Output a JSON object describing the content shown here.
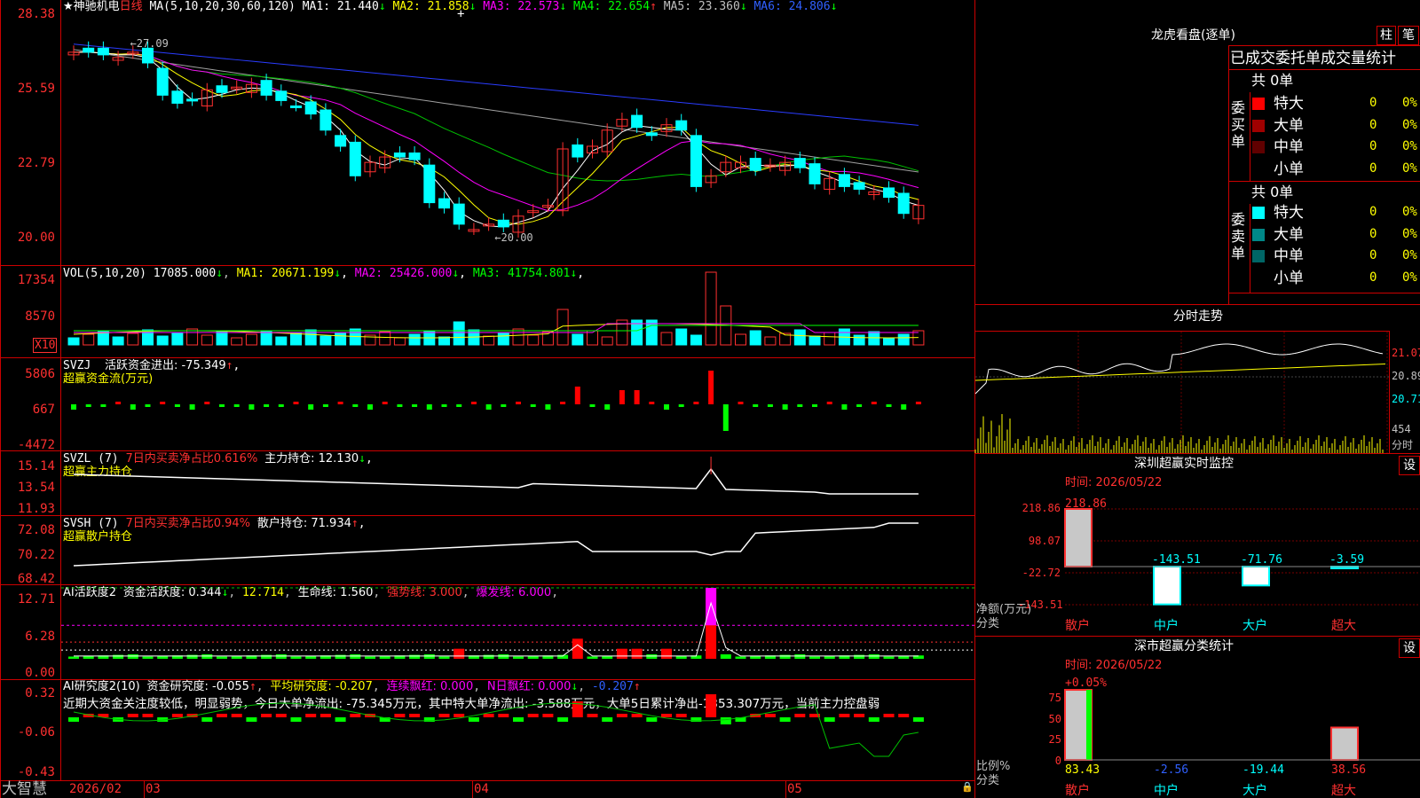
{
  "stock": {
    "name": "神驰机电",
    "period": "日线",
    "star": "★"
  },
  "kline": {
    "ma_prefix": "MA(5,10,20,30,60,120)",
    "ma": [
      {
        "label": "MA1: 21.440",
        "arrow": "↓",
        "color": "#ffffff"
      },
      {
        "label": "MA2: 21.858",
        "arrow": "↓",
        "color": "#ffff00"
      },
      {
        "label": "MA3: 22.573",
        "arrow": "↓",
        "color": "#ff00ff"
      },
      {
        "label": "MA4: 22.654",
        "arrow": "↑",
        "color": "#00ff00"
      },
      {
        "label": "MA5: 23.360",
        "arrow": "↓",
        "color": "#c0c0c0"
      },
      {
        "label": "MA6: 24.806",
        "arrow": "↓",
        "color": "#3060ff"
      }
    ],
    "yticks": [
      "28.38",
      "25.59",
      "22.79",
      "20.00"
    ],
    "high_mark": "27.09",
    "low_mark": "20.00",
    "closes": [
      26.9,
      26.9,
      26.8,
      26.7,
      26.9,
      26.5,
      25.3,
      25.0,
      25.1,
      25.5,
      25.4,
      25.6,
      25.7,
      25.3,
      25.1,
      24.9,
      24.6,
      24.0,
      23.4,
      22.3,
      22.8,
      23.0,
      23.0,
      22.9,
      21.3,
      21.1,
      20.5,
      20.3,
      20.5,
      20.4,
      20.8,
      21.0,
      21.2,
      23.3,
      23.0,
      23.4,
      24.0,
      24.4,
      24.1,
      23.8,
      24.2,
      24.0,
      21.9,
      22.3,
      22.8,
      22.8,
      22.5,
      22.7,
      22.8,
      22.6,
      22.0,
      22.2,
      21.9,
      21.8,
      21.7,
      21.5,
      20.9,
      21.2
    ]
  },
  "vol": {
    "prefix": "VOL(5,10,20)",
    "value": "17085.000",
    "arrow": "↓",
    "ma": [
      {
        "label": "MA1: 20671.199",
        "arrow": "↓",
        "color": "#ffff00"
      },
      {
        "label": "MA2: 25426.000",
        "arrow": "↓",
        "color": "#ff00ff"
      },
      {
        "label": "MA3: 41754.801",
        "arrow": "↓",
        "color": "#00ff00"
      }
    ],
    "yticks": [
      "17354",
      "8570",
      "X10"
    ]
  },
  "svzj": {
    "prefix": "SVZJ",
    "label": "活跃资金进出: -75.349",
    "arrow": "↑",
    "suffix": ",",
    "name": "超赢资金流(万元)",
    "yticks": [
      "5806",
      "667",
      "-4472"
    ]
  },
  "svzl": {
    "prefix": "SVZL (7)",
    "label1": "7日内买卖净占比0.616%",
    "label2": "主力持仓: 12.130",
    "arrow": "↓",
    "suffix": ",",
    "name": "超赢主力持仓",
    "yticks": [
      "15.14",
      "13.54",
      "11.93"
    ]
  },
  "svsh": {
    "prefix": "SVSH (7)",
    "label1": "7日内买卖净占比0.94%",
    "label2": "散户持仓: 71.934",
    "arrow": "↑",
    "suffix": ",",
    "name": "超赢散户持仓",
    "yticks": [
      "72.08",
      "70.22",
      "68.42"
    ]
  },
  "ai2": {
    "prefix": "AI活跃度2",
    "l1": "资金活跃度: 0.344",
    "a1": "↓",
    "l2": "12.714",
    "l3": "生命线: 1.560",
    "l4": "强势线: 3.000",
    "l5": "爆发线: 6.000",
    "yticks": [
      "12.71",
      "6.28",
      "0.00"
    ]
  },
  "ai_research": {
    "prefix": "AI研究度2(10)",
    "l1": "资金研究度: -0.055",
    "a1": "↑",
    "l2": "平均研究度: -0.207",
    "l3": "连续飘红: 0.000",
    "l4": "N日飘红: 0.000",
    "a4": "↓",
    "l5": "-0.207",
    "a5": "↑",
    "comment": "近期大资金关注度较低，明显弱势，今日大单净流出: -75.345万元，其中特大单净流出: -3.588万元，大单5日累计净出-1353.307万元，当前主力控盘弱",
    "yticks": [
      "0.32",
      "-0.06",
      "-0.43"
    ]
  },
  "footer": {
    "brand": "大智慧",
    "dates": [
      "2026/02",
      "03",
      "04",
      "05"
    ]
  },
  "longhu": {
    "title": "龙虎看盘(逐单)",
    "btn1": "柱",
    "btn2": "笔",
    "header": "已成交委托单成交量统计",
    "buy": {
      "side": "委买单",
      "total": "共 0单",
      "rows": [
        {
          "label": "特大",
          "v": "0",
          "p": "0%",
          "color": "#ff0000"
        },
        {
          "label": "大单",
          "v": "0",
          "p": "0%",
          "color": "#a00000"
        },
        {
          "label": "中单",
          "v": "0",
          "p": "0%",
          "color": "#600000"
        },
        {
          "label": "小单",
          "v": "0",
          "p": "0%",
          "color": ""
        }
      ]
    },
    "sell": {
      "side": "委卖单",
      "total": "共 0单",
      "rows": [
        {
          "label": "特大",
          "v": "0",
          "p": "0%",
          "color": "#00ffff"
        },
        {
          "label": "大单",
          "v": "0",
          "p": "0%",
          "color": "#008888"
        },
        {
          "label": "中单",
          "v": "0",
          "p": "0%",
          "color": "#006666"
        },
        {
          "label": "小单",
          "v": "0",
          "p": "0%",
          "color": ""
        }
      ]
    }
  },
  "fenshi": {
    "title": "分时走势",
    "yticks": [
      "21.07",
      "20.89",
      "20.71"
    ],
    "vol_label": "454",
    "vol_unit": "分时"
  },
  "monitor": {
    "title": "深圳超赢实时监控",
    "btn": "设",
    "time": "时间: 2026/05/22",
    "yticks": [
      "218.86",
      "98.07",
      "-22.72",
      "-143.51"
    ],
    "ylabel": "净额(万元)",
    "xlabel": "分类",
    "cats": [
      "散户",
      "中户",
      "大户",
      "超大"
    ],
    "values": [
      218.86,
      -143.51,
      -71.76,
      -3.59
    ],
    "value_labels": [
      "218.86",
      "-143.51",
      "-71.76",
      "-3.59"
    ]
  },
  "classify": {
    "title": "深市超赢分类统计",
    "btn": "设",
    "time": "时间: 2026/05/22",
    "top": "+0.05%",
    "yticks": [
      "75",
      "50",
      "25",
      "0"
    ],
    "ylabel": "比例%",
    "xlabel": "分类",
    "cats": [
      "散户",
      "中户",
      "大户",
      "超大"
    ],
    "values": [
      83.43,
      -2.56,
      -19.44,
      38.56
    ],
    "value_labels": [
      "83.43",
      "-2.56",
      "-19.44",
      "38.56"
    ]
  }
}
